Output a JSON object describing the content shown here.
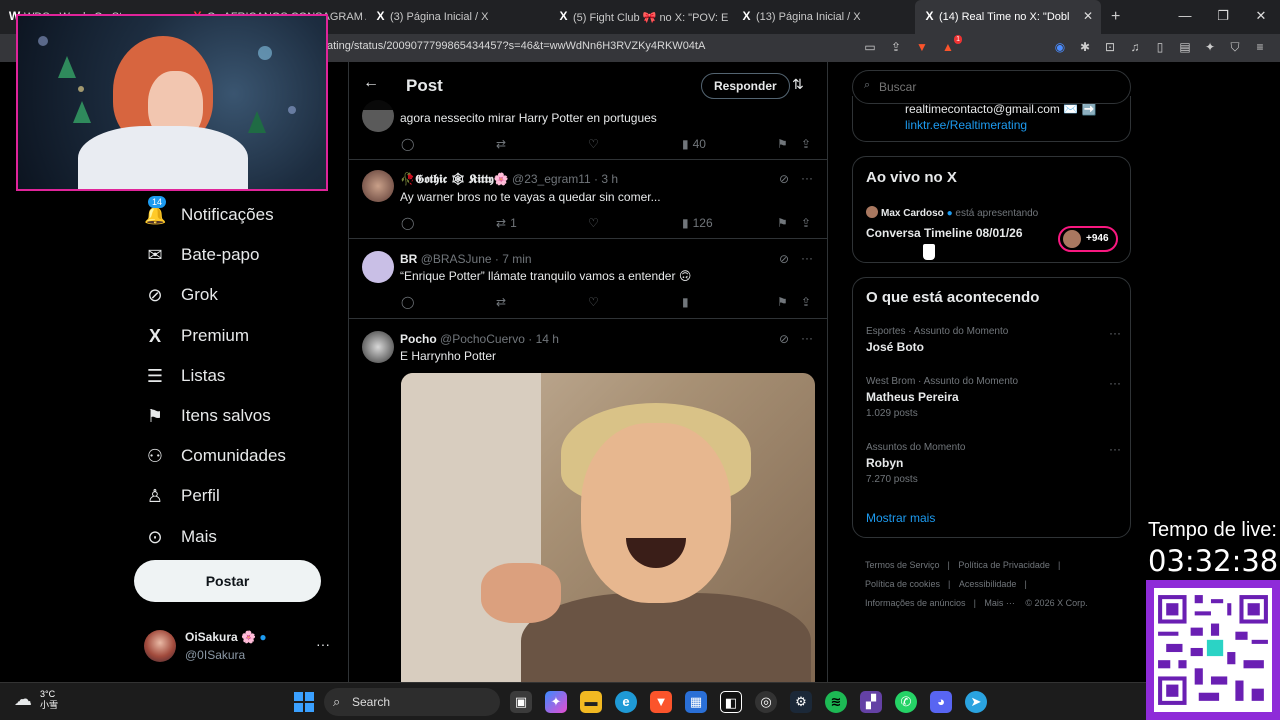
{
  "browser": {
    "tabs": [
      {
        "label": "WDS - Words On Stream",
        "icon": "W"
      },
      {
        "label": "Os AFRICANOS CONSAGRAM A",
        "icon": "Y"
      },
      {
        "label": "(3) Página Inicial / X",
        "icon": "X"
      },
      {
        "label": "(5) Fight Club 🎀 no X: \"POV: E",
        "icon": "X"
      },
      {
        "label": "(13) Página Inicial / X",
        "icon": "X"
      },
      {
        "label": "(14) Real Time no X: \"Doble b",
        "icon": "X"
      }
    ],
    "url": "ating/status/2009077799865434457?s=46&t=wwWdNn6H3RVZKy4RKW04tA",
    "new_tab": "+",
    "close_tab": "✕",
    "notif_count": "1"
  },
  "nav": {
    "items": [
      {
        "label": "Notificações",
        "icon": "bell-icon",
        "glyph": "🔔",
        "badge": "14"
      },
      {
        "label": "Bate-papo",
        "icon": "mail-icon",
        "glyph": "✉"
      },
      {
        "label": "Grok",
        "icon": "grok-icon",
        "glyph": "⊘"
      },
      {
        "label": "Premium",
        "icon": "x-logo-icon",
        "glyph": "𝕏"
      },
      {
        "label": "Listas",
        "icon": "list-icon",
        "glyph": "☰"
      },
      {
        "label": "Itens salvos",
        "icon": "bookmark-icon",
        "glyph": "🔖"
      },
      {
        "label": "Comunidades",
        "icon": "people-icon",
        "glyph": "👥"
      },
      {
        "label": "Perfil",
        "icon": "person-icon",
        "glyph": "👤"
      },
      {
        "label": "Mais",
        "icon": "more-circle-icon",
        "glyph": "⋯"
      }
    ],
    "post_button": "Postar",
    "user": {
      "name": "OiSakura 🌸",
      "handle": "@0ISakura"
    }
  },
  "main": {
    "title": "Post",
    "reply_button": "Responder",
    "tweets": [
      {
        "author": "",
        "handle": "",
        "time": "",
        "text": "agora nessecito mirar Harry Potter en portugues",
        "retweets": "",
        "views": "40"
      },
      {
        "author": "🥀𝕲𝖔𝖙𝖍𝖎𝖈 🕸 𝕶𝖎𝖙𝖙𝖞🌸",
        "handle": "@23_egram11",
        "time": "3 h",
        "text": "Ay warner bros no te vayas a quedar sin comer...",
        "retweets": "1",
        "views": "126"
      },
      {
        "author": "BR",
        "handle": "@BRASJune",
        "time": "7 min",
        "text": "“Enrique Potter” llámate tranquilo vamos a entender 🙃",
        "retweets": "",
        "views": ""
      },
      {
        "author": "Pocho",
        "handle": "@PochoCuervo",
        "time": "14 h",
        "text": "E Harrynho Potter",
        "retweets": "",
        "views": ""
      }
    ]
  },
  "right": {
    "search_placeholder": "Buscar",
    "contact_email": "realtimecontacto@gmail.com ✉️ ➡️",
    "contact_link": "linktr.ee/Realtimerating",
    "live": {
      "heading": "Ao vivo no X",
      "host": "Max Cardoso",
      "host_suffix": "está apresentando",
      "space_title": "Conversa Timeline 08/01/26",
      "listeners": "+946"
    },
    "trends": {
      "heading": "O que está acontecendo",
      "items": [
        {
          "context": "Esportes · Assunto do Momento",
          "name": "José Boto",
          "posts": ""
        },
        {
          "context": "West Brom · Assunto do Momento",
          "name": "Matheus Pereira",
          "posts": "1.029 posts"
        },
        {
          "context": "Assuntos do Momento",
          "name": "Robyn",
          "posts": "7.270 posts"
        }
      ],
      "show_more": "Mostrar mais"
    },
    "footer": [
      "Termos de Serviço",
      "Política de Privacidade",
      "Política de cookies",
      "Acessibilidade",
      "Informações de anúncios",
      "Mais ···",
      "© 2026 X Corp."
    ]
  },
  "overlay": {
    "timer_label": "Tempo de live:",
    "timer": "03:32:38"
  },
  "taskbar": {
    "temp": "3°C",
    "condition": "小雪",
    "search": "Search"
  },
  "colors": {
    "accent": "#1d9bf0",
    "live_ring": "#f91880",
    "webcam_border": "#e0249a",
    "qr_frame": "#8e2bd8"
  }
}
